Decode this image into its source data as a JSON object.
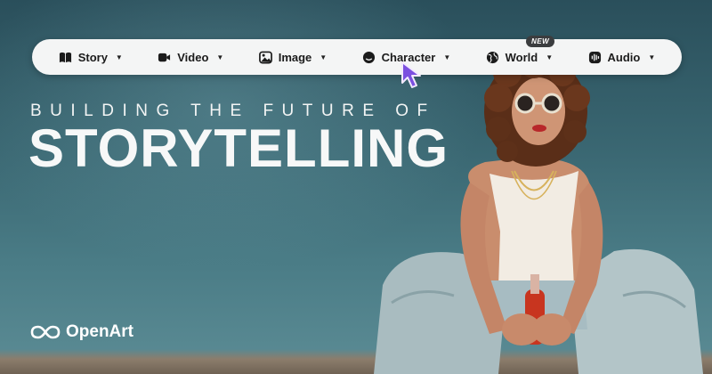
{
  "nav": {
    "items": [
      {
        "label": "Story",
        "icon": "book-icon"
      },
      {
        "label": "Video",
        "icon": "video-camera-icon"
      },
      {
        "label": "Image",
        "icon": "image-icon"
      },
      {
        "label": "Character",
        "icon": "smiley-icon"
      },
      {
        "label": "World",
        "icon": "globe-icon",
        "badge": "NEW"
      },
      {
        "label": "Audio",
        "icon": "audio-wave-icon"
      }
    ]
  },
  "hero": {
    "eyebrow": "BUILDING THE FUTURE OF",
    "headline": "STORYTELLING"
  },
  "brand": {
    "name": "OpenArt",
    "icon": "infinity-logo-icon"
  },
  "colors": {
    "accent_cursor": "#7b4fe0",
    "nav_bg": "#f4f5f5",
    "badge_bg": "#3b3d3f"
  }
}
